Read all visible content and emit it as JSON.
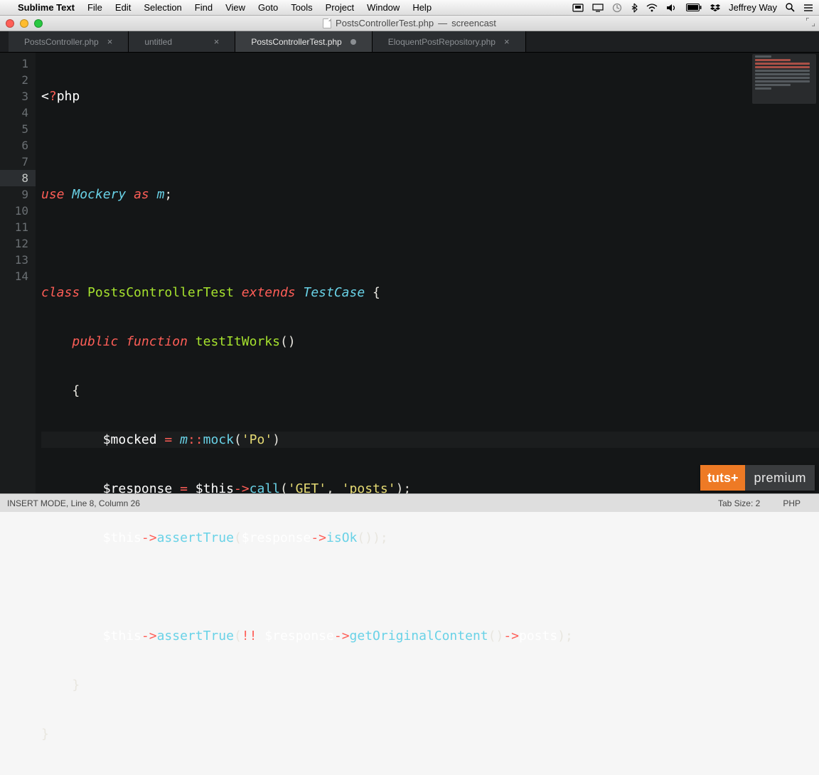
{
  "menubar": {
    "app_name": "Sublime Text",
    "items": [
      "File",
      "Edit",
      "Selection",
      "Find",
      "View",
      "Goto",
      "Tools",
      "Project",
      "Window",
      "Help"
    ],
    "right": {
      "user": "Jeffrey Way"
    }
  },
  "titlebar": {
    "filename": "PostsControllerTest.php",
    "project": "screencast"
  },
  "tabs": [
    {
      "label": "PostsController.php",
      "active": false,
      "dirty": false
    },
    {
      "label": "untitled",
      "active": false,
      "dirty": false
    },
    {
      "label": "PostsControllerTest.php",
      "active": true,
      "dirty": true
    },
    {
      "label": "EloquentPostRepository.php",
      "active": false,
      "dirty": false
    }
  ],
  "editor": {
    "line_numbers": [
      1,
      2,
      3,
      4,
      5,
      6,
      7,
      8,
      9,
      10,
      11,
      12,
      13,
      14
    ],
    "highlight_line": 8,
    "lines": {
      "l1": {
        "phptag_lt": "<",
        "phptag_q": "?",
        "phptag_rest": "php"
      },
      "l3": {
        "use": "use ",
        "ns": "Mockery ",
        "as": "as ",
        "alias": "m",
        "semi": ";"
      },
      "l5": {
        "class": "class ",
        "name": "PostsControllerTest ",
        "extends": "extends ",
        "base": "TestCase ",
        "brace": "{"
      },
      "l6": {
        "indent": "    ",
        "public": "public ",
        "function": "function ",
        "method": "testItWorks",
        "parens": "()"
      },
      "l7": {
        "indent": "    ",
        "brace": "{"
      },
      "l8": {
        "indent": "        ",
        "var": "$mocked ",
        "eq": "= ",
        "m": "m",
        "dcolon": "::",
        "call": "mock",
        "open": "(",
        "str": "'Po'",
        "close": ")"
      },
      "l9": {
        "indent": "        ",
        "var": "$response ",
        "eq": "= ",
        "this": "$this",
        "arrow": "->",
        "call": "call",
        "open": "(",
        "str1": "'GET'",
        "comma": ", ",
        "str2": "'posts'",
        "close": ");"
      },
      "l10": {
        "indent": "        ",
        "this": "$this",
        "arrow": "->",
        "call": "assertTrue",
        "open": "(",
        "var": "$response",
        "arrow2": "->",
        "call2": "isOk",
        "close": "());"
      },
      "l12": {
        "indent": "        ",
        "this": "$this",
        "arrow": "->",
        "call": "assertTrue",
        "open": "(",
        "bang": "!! ",
        "var": "$response",
        "arrow2": "->",
        "call2": "getOriginalContent",
        "mid": "()",
        "arrow3": "->",
        "prop": "posts",
        "close": ");"
      },
      "l13": {
        "indent": "    ",
        "brace": "}"
      },
      "l14": {
        "brace": "}"
      }
    }
  },
  "statusbar": {
    "left": "INSERT MODE, Line 8, Column 26",
    "tab_size": "Tab Size: 2",
    "syntax": "PHP"
  },
  "badge": {
    "a": "tuts+",
    "b": "premium"
  }
}
